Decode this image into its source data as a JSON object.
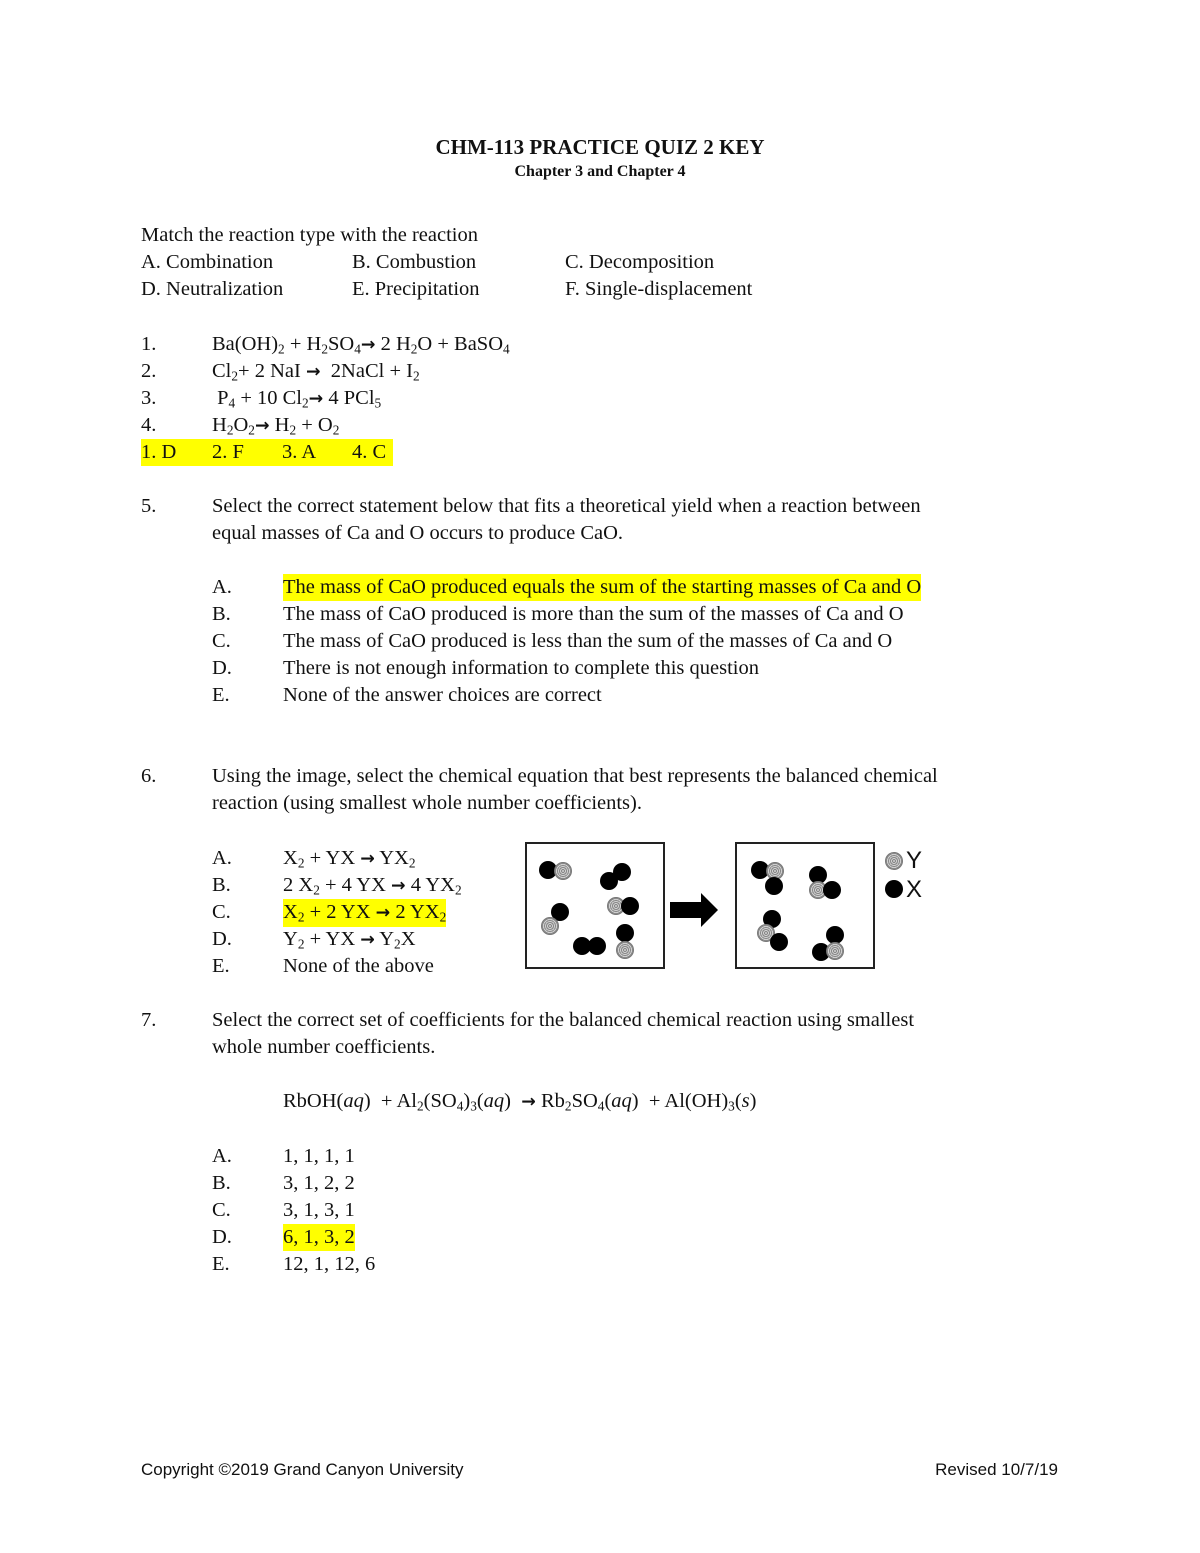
{
  "header": {
    "title": "CHM-113 PRACTICE QUIZ 2 KEY",
    "subtitle": "Chapter 3 and Chapter 4"
  },
  "matching": {
    "instruction": "Match the reaction type with the reaction",
    "types": [
      "A. Combination",
      "B. Combustion",
      "C. Decomposition",
      "D. Neutralization",
      "E. Precipitation",
      "F. Single-displacement"
    ],
    "reactions": [
      {
        "num": "1.",
        "parts": [
          [
            "Ba(OH)",
            ""
          ],
          [
            "2",
            "sub"
          ],
          [
            " + H",
            ""
          ],
          [
            "2",
            "sub"
          ],
          [
            "SO",
            ""
          ],
          [
            "4",
            "sub"
          ],
          [
            " ",
            "arrow"
          ],
          [
            " 2 H",
            ""
          ],
          [
            "2",
            "sub"
          ],
          [
            "O + BaSO",
            ""
          ],
          [
            "4",
            "sub"
          ]
        ]
      },
      {
        "num": "2.",
        "parts": [
          [
            "Cl",
            ""
          ],
          [
            "2",
            "sub"
          ],
          [
            "+ 2 NaI ",
            ""
          ],
          [
            " ",
            "arrow"
          ],
          [
            "  2NaCl + I",
            ""
          ],
          [
            "2",
            "sub"
          ]
        ]
      },
      {
        "num": "3.",
        "parts": [
          [
            " P",
            ""
          ],
          [
            "4",
            "sub"
          ],
          [
            " + 10 Cl",
            ""
          ],
          [
            "2",
            "sub"
          ],
          [
            " ",
            "arrow"
          ],
          [
            " 4 PCl",
            ""
          ],
          [
            "5",
            "sub"
          ]
        ]
      },
      {
        "num": "4.",
        "parts": [
          [
            "H",
            ""
          ],
          [
            "2",
            "sub"
          ],
          [
            "O",
            ""
          ],
          [
            "2",
            "sub"
          ],
          [
            " ",
            "arrow"
          ],
          [
            " H",
            ""
          ],
          [
            "2",
            "sub"
          ],
          [
            " + O",
            ""
          ],
          [
            "2",
            "sub"
          ]
        ]
      }
    ],
    "answer_key": [
      "1. D",
      "2. F",
      "3. A",
      "4. C"
    ],
    "arrow_symbol": "→"
  },
  "q5": {
    "num": "5.",
    "text_line1": "Select the correct statement below that fits a theoretical yield when a reaction between",
    "text_line2": "equal masses of Ca and O occurs to produce CaO.",
    "options": [
      {
        "letter": "A.",
        "text": "The mass of CaO produced equals the sum of the starting masses of Ca and O",
        "correct": true
      },
      {
        "letter": "B.",
        "text": "The mass of CaO produced is more than the sum of the masses of Ca and O",
        "correct": false
      },
      {
        "letter": "C.",
        "text": "The mass of CaO produced is less than the sum of the masses of Ca and O",
        "correct": false
      },
      {
        "letter": "D.",
        "text": "There is not enough information to complete this question",
        "correct": false
      },
      {
        "letter": "E.",
        "text": "None of the answer choices are correct",
        "correct": false
      }
    ]
  },
  "q6": {
    "num": "6.",
    "text_line1": "Using the image, select the chemical equation that best represents the balanced chemical",
    "text_line2": "reaction (using smallest whole number coefficients).",
    "options": [
      {
        "letter": "A.",
        "parts": [
          [
            "X",
            ""
          ],
          [
            "2",
            "sub"
          ],
          [
            " + YX ",
            ""
          ],
          [
            " ",
            "arrow"
          ],
          [
            " YX",
            ""
          ],
          [
            "2",
            "sub"
          ]
        ],
        "correct": false
      },
      {
        "letter": "B.",
        "parts": [
          [
            "2 X",
            ""
          ],
          [
            "2",
            "sub"
          ],
          [
            " + 4 YX ",
            ""
          ],
          [
            " ",
            "arrow"
          ],
          [
            " 4 YX",
            ""
          ],
          [
            "2",
            "sub"
          ]
        ],
        "correct": false
      },
      {
        "letter": "C.",
        "parts": [
          [
            "X",
            ""
          ],
          [
            "2",
            "sub"
          ],
          [
            " + 2 YX ",
            ""
          ],
          [
            " ",
            "arrow"
          ],
          [
            " 2 YX",
            ""
          ],
          [
            "2",
            "sub"
          ]
        ],
        "correct": true
      },
      {
        "letter": "D.",
        "parts": [
          [
            "Y",
            ""
          ],
          [
            "2",
            "sub"
          ],
          [
            " + YX ",
            ""
          ],
          [
            " ",
            "arrow"
          ],
          [
            " Y",
            ""
          ],
          [
            "2",
            "sub"
          ],
          [
            "X",
            ""
          ]
        ],
        "correct": false
      },
      {
        "letter": "E.",
        "parts": [
          [
            "None of the above",
            ""
          ]
        ],
        "correct": false
      }
    ],
    "diagram": {
      "legend": [
        {
          "label": "Y",
          "atom": "hatched-gray"
        },
        {
          "label": "X",
          "atom": "solid-black"
        }
      ],
      "reactants": [
        "YX",
        "X2",
        "YX",
        "YX",
        "X2",
        "YX"
      ],
      "products": [
        "YX2",
        "YX2",
        "YX2",
        "YX2"
      ]
    }
  },
  "q7": {
    "num": "7.",
    "text_line1": "Select the correct set of coefficients for the balanced chemical reaction using smallest",
    "text_line2": "whole number coefficients.",
    "equation_parts": [
      [
        "RbOH(",
        ""
      ],
      [
        "aq",
        "i"
      ],
      [
        ")  + Al",
        ""
      ],
      [
        "2",
        "sub"
      ],
      [
        "(SO",
        ""
      ],
      [
        "4",
        "sub"
      ],
      [
        ")",
        ""
      ],
      [
        "3",
        "sub"
      ],
      [
        "(",
        ""
      ],
      [
        "aq",
        "i"
      ],
      [
        ")  ",
        ""
      ],
      [
        " ",
        "arrow"
      ],
      [
        " Rb",
        ""
      ],
      [
        "2",
        "sub"
      ],
      [
        "SO",
        ""
      ],
      [
        "4",
        "sub"
      ],
      [
        "(",
        ""
      ],
      [
        "aq",
        "i"
      ],
      [
        ")  + Al(OH)",
        ""
      ],
      [
        "3",
        "sub"
      ],
      [
        "(",
        ""
      ],
      [
        "s",
        "i"
      ],
      [
        ")",
        ""
      ]
    ],
    "options": [
      {
        "letter": "A.",
        "text": "1, 1, 1, 1",
        "correct": false
      },
      {
        "letter": "B.",
        "text": "3, 1, 2, 2",
        "correct": false
      },
      {
        "letter": "C.",
        "text": "3, 1, 3, 1",
        "correct": false
      },
      {
        "letter": "D.",
        "text": "6, 1, 3, 2",
        "correct": true
      },
      {
        "letter": "E.",
        "text": "12, 1, 12, 6",
        "correct": false
      }
    ]
  },
  "footer": {
    "copyright": "Copyright ©2019 Grand Canyon University",
    "revised": "Revised 10/7/19"
  },
  "colors": {
    "highlight": "#ffff00"
  }
}
